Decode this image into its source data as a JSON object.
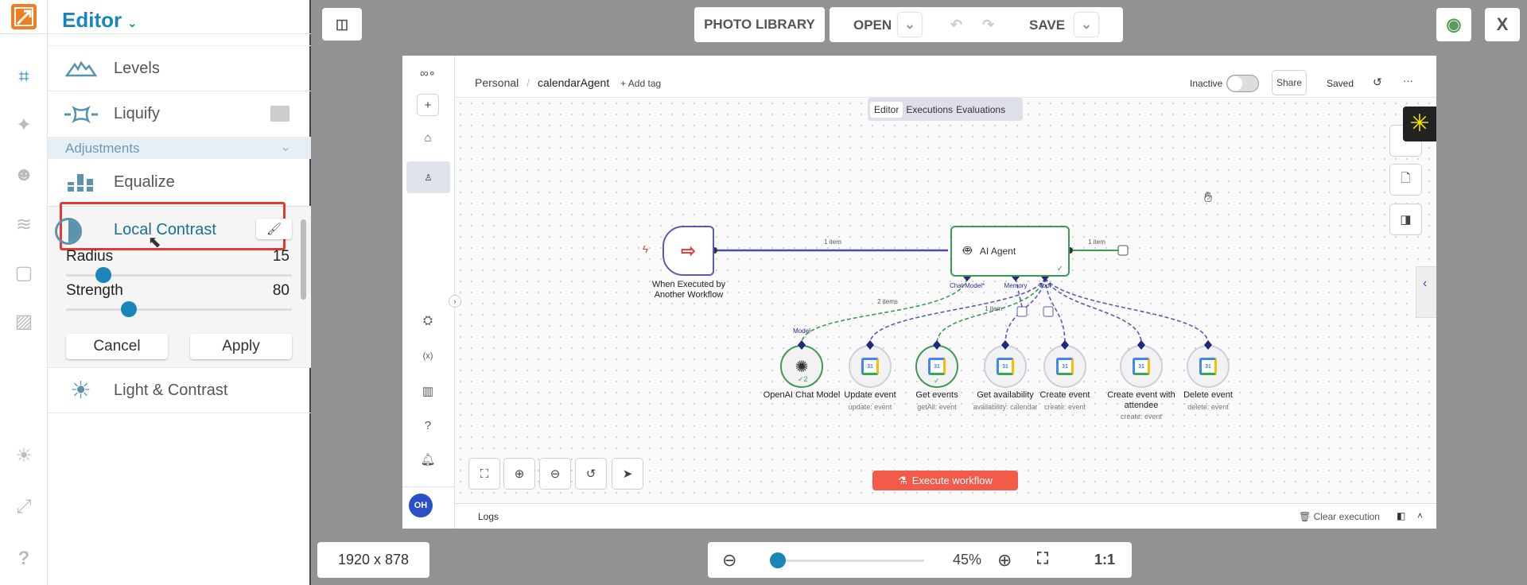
{
  "app": {
    "title": "Editor",
    "accent": "#1a85b8",
    "highlight_color": "#e53935"
  },
  "rail": {
    "icons": [
      "crop-icon",
      "magic-wand-icon",
      "face-icon",
      "layers-icon",
      "frame-icon",
      "texture-icon",
      "lightbulb-icon",
      "fullscreen-icon",
      "help-icon"
    ]
  },
  "panel": {
    "items": [
      {
        "label": "Levels",
        "icon": "levels-icon"
      },
      {
        "label": "Liquify",
        "icon": "liquify-icon"
      }
    ],
    "section": "Adjustments",
    "equalize": "Equalize",
    "local_contrast": {
      "label": "Local Contrast",
      "radius_label": "Radius",
      "radius_value": "15",
      "strength_label": "Strength",
      "strength_value": "80",
      "cancel": "Cancel",
      "apply": "Apply"
    },
    "light_contrast": "Light & Contrast"
  },
  "toolbar": {
    "photo_library": "PHOTO LIBRARY",
    "open": "OPEN",
    "save": "SAVE",
    "close": "X"
  },
  "footer": {
    "image_size": "1920 x 878",
    "zoom": "45%",
    "zoom_value": 45,
    "one_to_one": "1:1"
  },
  "n8n": {
    "breadcrumb": {
      "project": "Personal",
      "sep": "/",
      "workflow": "calendarAgent",
      "add_tag": "+ Add tag"
    },
    "status": "Inactive",
    "share": "Share",
    "saved": "Saved",
    "more": "···",
    "tabs": [
      "Editor",
      "Executions",
      "Evaluations"
    ],
    "avatar": "OH",
    "trigger": {
      "label_line1": "When Executed by",
      "label_line2": "Another Workflow"
    },
    "edge_main": "1 item",
    "edge_out": "1 item",
    "agent": {
      "label": "AI Agent",
      "ports": [
        "Chat Model*",
        "Memory",
        "Tool"
      ]
    },
    "edge_model": "2 items",
    "edge_tool": "1 item",
    "model_port": "Model",
    "subnodes": [
      {
        "label": "OpenAI Chat Model",
        "sub": "",
        "badge": "✓2"
      },
      {
        "label": "Update event",
        "sub": "update: event"
      },
      {
        "label": "Get events",
        "sub": "getAll: event",
        "badge": "✓"
      },
      {
        "label": "Get availability",
        "sub": "availability: calendar"
      },
      {
        "label": "Create event",
        "sub": "create: event"
      },
      {
        "label": "Create event with",
        "label2": "attendee",
        "sub": "create: event"
      },
      {
        "label": "Delete event",
        "sub": "delete: event"
      }
    ],
    "execute": "Execute workflow",
    "logs": "Logs",
    "clear": "Clear execution"
  }
}
